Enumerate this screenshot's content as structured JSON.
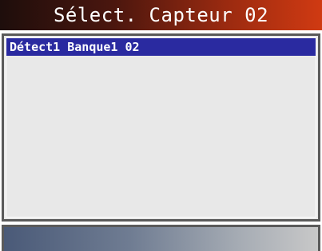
{
  "window": {
    "title": "Sélect. Capteur 02"
  },
  "list": {
    "items": [
      {
        "label": "Détect1 Banque1 02",
        "selected": true
      }
    ]
  },
  "colors": {
    "title_bar_dark": "#1e0e0c",
    "title_bar_light": "#d03a12",
    "selection_highlight": "#2a2aa0",
    "list_background": "#e8e8e8"
  }
}
